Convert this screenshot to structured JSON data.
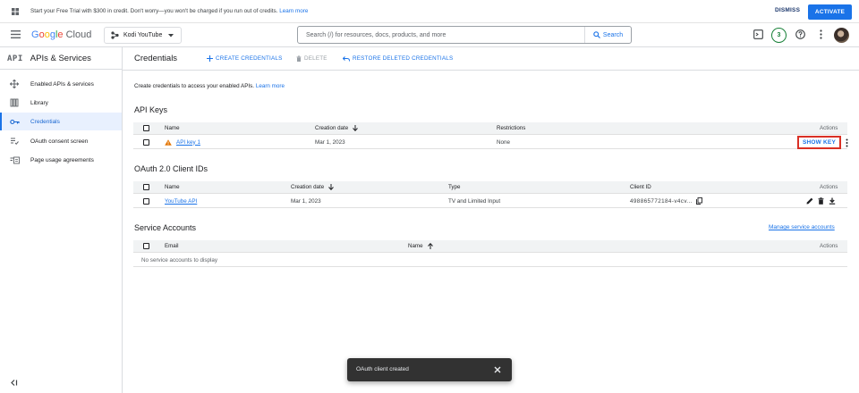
{
  "promo": {
    "message_prefix": "Start your Free Trial with $300 in credit. Don't worry—you won't be charged if you run out of credits.",
    "learn_more": "Learn more",
    "dismiss": "DISMISS",
    "activate": "ACTIVATE"
  },
  "header": {
    "logo_google": [
      "G",
      "o",
      "o",
      "g",
      "l",
      "e"
    ],
    "logo_cloud": "Cloud",
    "project": "Kodi YouTube",
    "search_placeholder": "Search (/) for resources, docs, products, and more",
    "search_button": "Search",
    "notifications_count": "3"
  },
  "sidebar": {
    "api_badge": "API",
    "title": "APIs & Services",
    "items": [
      {
        "label": "Enabled APIs & services",
        "icon": "enabled-apis-icon"
      },
      {
        "label": "Library",
        "icon": "library-icon"
      },
      {
        "label": "Credentials",
        "icon": "key-icon",
        "active": true
      },
      {
        "label": "OAuth consent screen",
        "icon": "consent-icon"
      },
      {
        "label": "Page usage agreements",
        "icon": "agreements-icon"
      }
    ]
  },
  "toolbar": {
    "page_title": "Credentials",
    "create": "CREATE CREDENTIALS",
    "delete": "DELETE",
    "restore": "RESTORE DELETED CREDENTIALS"
  },
  "main": {
    "intro_text": "Create credentials to access your enabled APIs.",
    "intro_link": "Learn more",
    "api_keys": {
      "title": "API Keys",
      "columns": {
        "name": "Name",
        "creation_date": "Creation date",
        "restrictions": "Restrictions",
        "actions": "Actions"
      },
      "rows": [
        {
          "name": "API key 1",
          "creation_date": "Mar 1, 2023",
          "restrictions": "None",
          "action": "SHOW KEY"
        }
      ]
    },
    "oauth": {
      "title": "OAuth 2.0 Client IDs",
      "columns": {
        "name": "Name",
        "creation_date": "Creation date",
        "type": "Type",
        "client_id": "Client ID",
        "actions": "Actions"
      },
      "rows": [
        {
          "name": "YouTube API",
          "creation_date": "Mar 1, 2023",
          "type": "TV and Limited Input",
          "client_id": "498865772184-v4cv..."
        }
      ]
    },
    "service_accounts": {
      "title": "Service Accounts",
      "manage_link": "Manage service accounts",
      "columns": {
        "email": "Email",
        "name": "Name",
        "actions": "Actions"
      },
      "empty": "No service accounts to display"
    }
  },
  "toast": {
    "message": "OAuth client created"
  },
  "colors": {
    "accent": "#1a73e8",
    "highlight_border": "#d93025",
    "warning": "#e37400"
  }
}
